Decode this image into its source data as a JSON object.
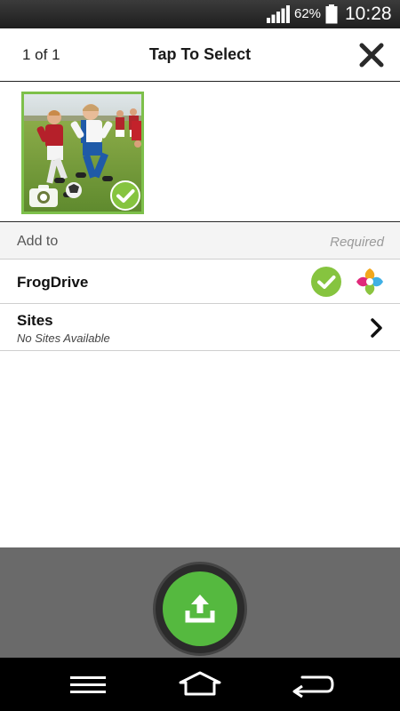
{
  "status_bar": {
    "battery_percent": "62%",
    "time": "10:28"
  },
  "header": {
    "count": "1 of 1",
    "title": "Tap To Select",
    "close_icon": "close-icon"
  },
  "gallery": {
    "items": [
      {
        "type": "photo",
        "selected": true,
        "badge_icon": "camera-icon"
      }
    ]
  },
  "add_to": {
    "label": "Add to",
    "hint": "Required"
  },
  "destinations": [
    {
      "label": "FrogDrive",
      "selected": true,
      "icon": "frog-logo-icon"
    },
    {
      "label": "Sites",
      "subtitle": "No Sites Available",
      "icon": "chevron-right-icon"
    }
  ],
  "actions": {
    "upload_icon": "upload-icon"
  },
  "nav_bar": {
    "items": [
      "menu-icon",
      "home-icon",
      "back-icon"
    ]
  },
  "colors": {
    "accent_green": "#7dc04a",
    "upload_green": "#55b93f",
    "bottom_bar": "#6a6a6a"
  }
}
